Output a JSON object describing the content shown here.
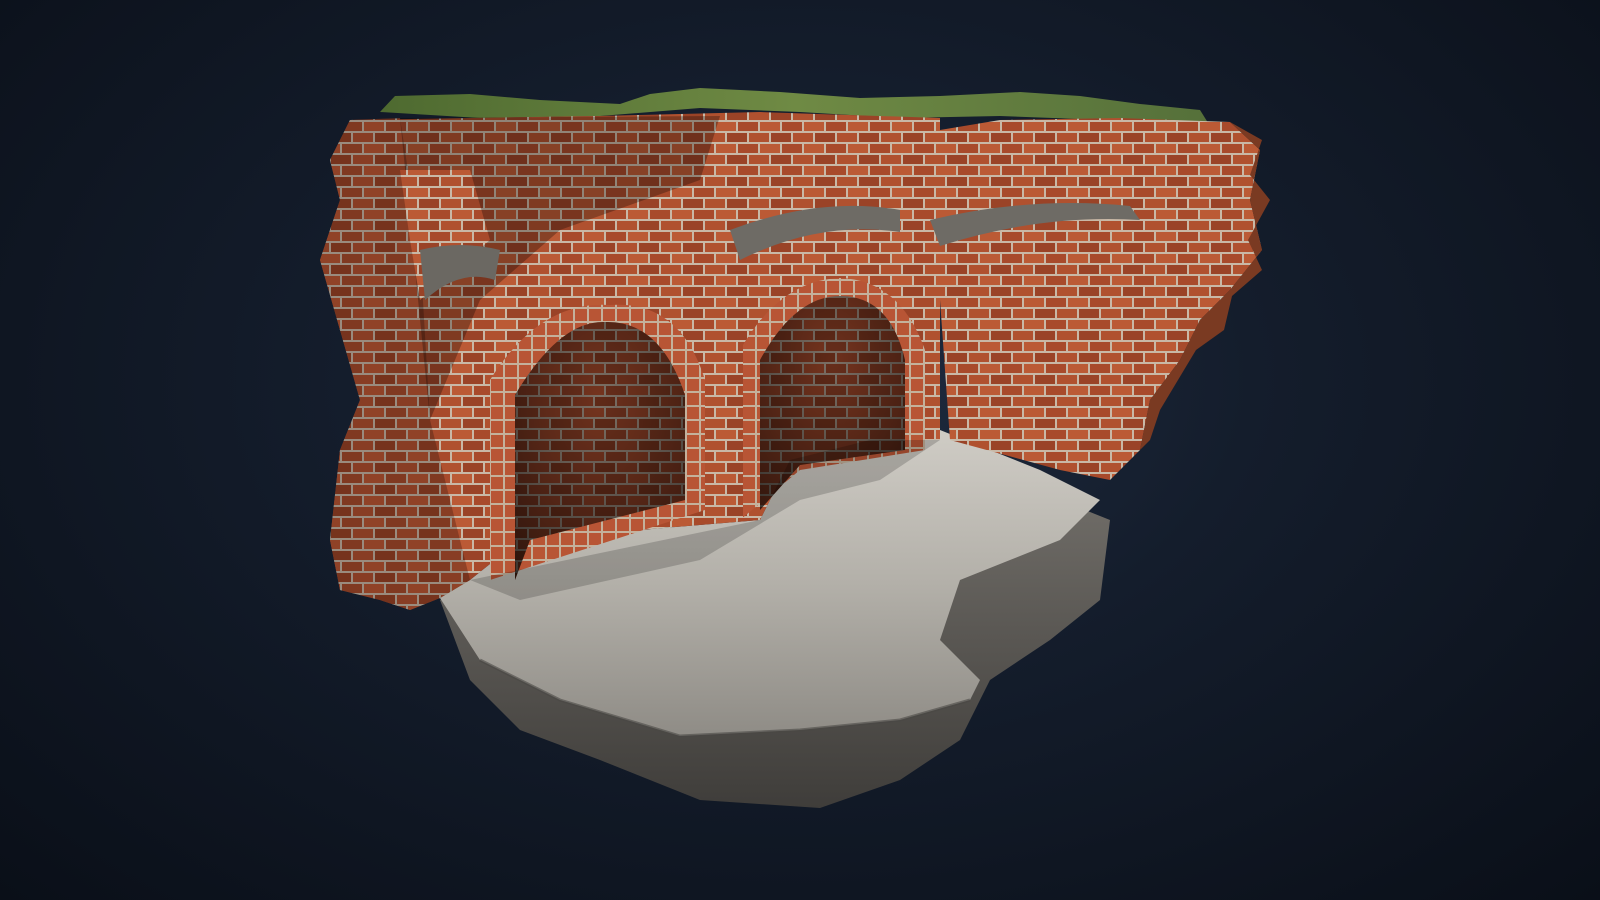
{
  "scene": {
    "subject": "ruined-brick-arches-diorama",
    "colors": {
      "background_center": "#1f2c40",
      "background_edge": "#0a0f18",
      "brick": "#a7482c",
      "brick_dark": "#5a2414",
      "mortar": "#c9b8a6",
      "stone_floor": "#a9a6a0",
      "rock_side": "#5c5a56",
      "moss": "#5f7a3a"
    }
  }
}
